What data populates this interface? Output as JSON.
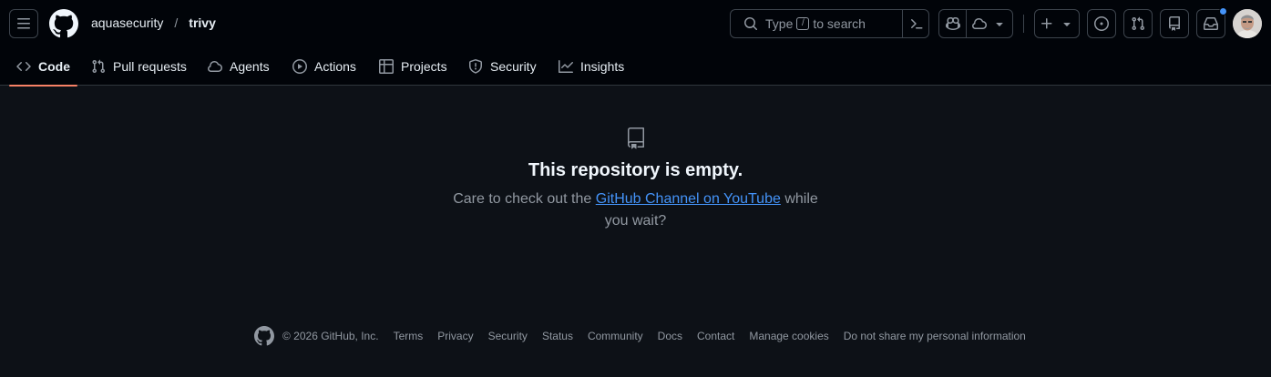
{
  "header": {
    "owner": "aquasecurity",
    "separator": "/",
    "repo": "trivy",
    "search": {
      "prefix": "Type",
      "key": "/",
      "suffix": "to search"
    }
  },
  "nav": {
    "tabs": [
      {
        "label": "Code",
        "icon": "code-icon",
        "selected": true
      },
      {
        "label": "Pull requests",
        "icon": "git-pull-request-icon"
      },
      {
        "label": "Agents",
        "icon": "agent-icon"
      },
      {
        "label": "Actions",
        "icon": "play-icon"
      },
      {
        "label": "Projects",
        "icon": "table-icon"
      },
      {
        "label": "Security",
        "icon": "shield-icon"
      },
      {
        "label": "Insights",
        "icon": "graph-icon"
      }
    ]
  },
  "blankslate": {
    "title": "This repository is empty.",
    "text_before": "Care to check out the",
    "link": "GitHub Channel on YouTube",
    "text_after": "while you wait?"
  },
  "footer": {
    "copyright": "© 2026 GitHub, Inc.",
    "links": [
      "Terms",
      "Privacy",
      "Security",
      "Status",
      "Community",
      "Docs",
      "Contact",
      "Manage cookies",
      "Do not share my personal information"
    ]
  },
  "colors": {
    "header_bg": "#010409",
    "page_bg": "#0d1117",
    "accent_link": "#4493f8",
    "tab_underline": "#f78166",
    "notification_dot": "#4493f8"
  }
}
